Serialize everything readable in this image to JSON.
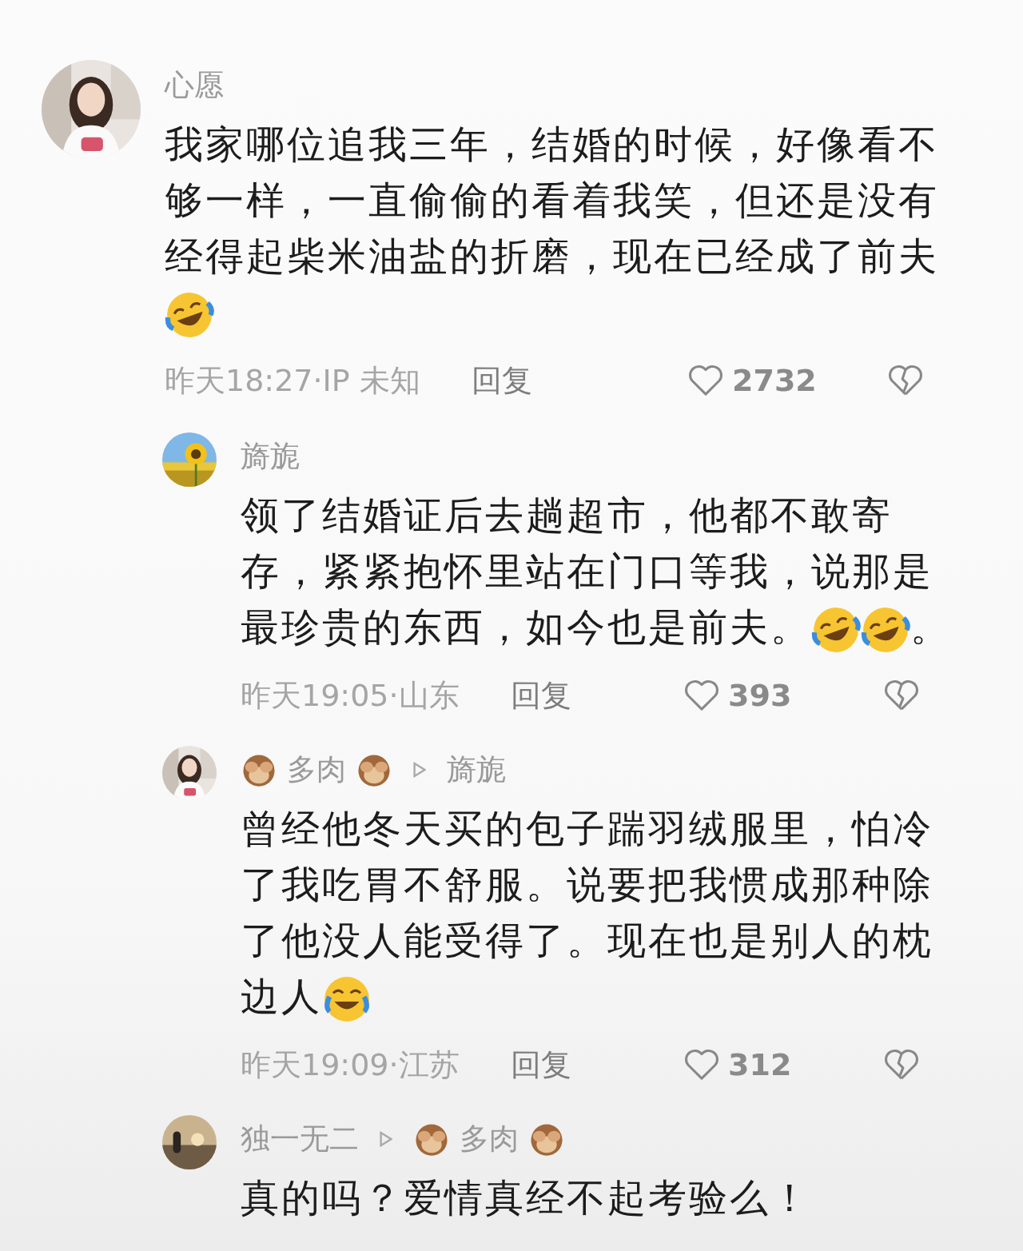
{
  "comments": [
    {
      "kind": "top",
      "author": [
        {
          "kind": "name",
          "text": "心愿"
        }
      ],
      "body": [
        {
          "kind": "text",
          "text": "我家哪位追我三年，结婚的时候，好像看不够一样，一直偷偷的看着我笑，但还是没有经得起柴米油盐的折磨，现在已经成了前夫"
        },
        {
          "kind": "rofl"
        }
      ],
      "meta": "昨天18:27·IP 未知",
      "reply_label": "回复",
      "likes": "2732"
    },
    {
      "kind": "reply",
      "author": [
        {
          "kind": "name",
          "text": "旖旎"
        }
      ],
      "body": [
        {
          "kind": "text",
          "text": "领了结婚证后去趟超市，他都不敢寄存，紧紧抱怀里站在门口等我，说那是"
        },
        {
          "kind": "text",
          "text": "最珍贵的东西，如今也是前夫。"
        },
        {
          "kind": "rofl"
        },
        {
          "kind": "rofl"
        },
        {
          "kind": "text",
          "text": "。"
        }
      ],
      "meta": "昨天19:05·山东",
      "reply_label": "回复",
      "likes": "393"
    },
    {
      "kind": "reply",
      "author": [
        {
          "kind": "monkey"
        },
        {
          "kind": "name",
          "text": "多肉"
        },
        {
          "kind": "monkey"
        }
      ],
      "reply_to": [
        {
          "kind": "name",
          "text": "旖旎"
        }
      ],
      "body": [
        {
          "kind": "text",
          "text": "曾经他冬天买的包子踹羽绒服里，怕冷了我吃胃不舒服。说要把我惯成那种除了他没人能受得了。现在也是别人的枕"
        },
        {
          "kind": "text",
          "text": "边人"
        },
        {
          "kind": "tears"
        }
      ],
      "meta": "昨天19:09·江苏",
      "reply_label": "回复",
      "likes": "312"
    },
    {
      "kind": "reply",
      "author": [
        {
          "kind": "name",
          "text": "独一无二"
        }
      ],
      "reply_to": [
        {
          "kind": "monkey"
        },
        {
          "kind": "name",
          "text": "多肉"
        },
        {
          "kind": "monkey"
        }
      ],
      "body": [
        {
          "kind": "text",
          "text": "真的吗？爱情真经不起考验么！"
        }
      ]
    }
  ]
}
